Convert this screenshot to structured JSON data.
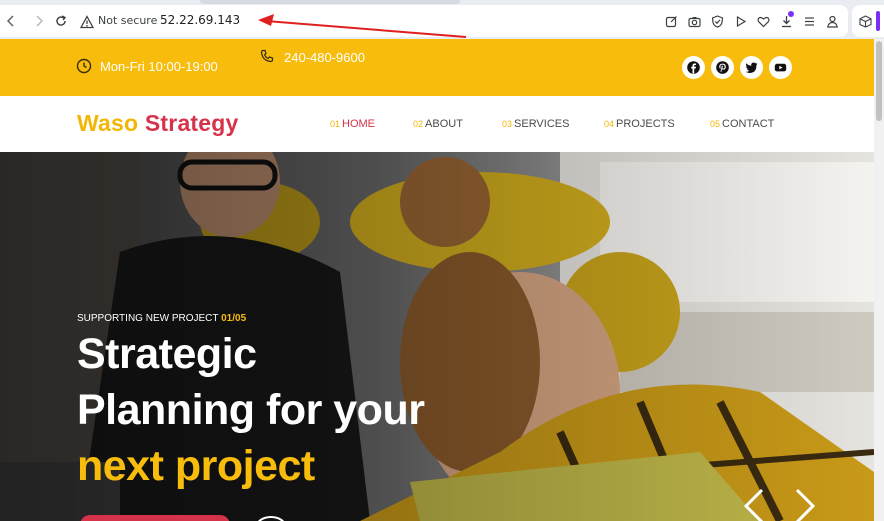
{
  "browser": {
    "security_status": "Not secure",
    "url": "52.22.69.143"
  },
  "topbar": {
    "hours": "Mon-Fri 10:00-19:00",
    "phone": "240-480-9600",
    "social_icons": [
      "facebook-icon",
      "pinterest-icon",
      "twitter-icon",
      "youtube-icon"
    ]
  },
  "header": {
    "logo_part1": "Waso",
    "logo_part2": "Strategy",
    "nav": [
      {
        "num": "01",
        "label": "HOME"
      },
      {
        "num": "02",
        "label": "ABOUT"
      },
      {
        "num": "03",
        "label": "SERVICES"
      },
      {
        "num": "04",
        "label": "PROJECTS"
      },
      {
        "num": "05",
        "label": "CONTACT"
      }
    ]
  },
  "hero": {
    "kicker": "SUPPORTING NEW PROJECT",
    "counter": "01/05",
    "line1": "Strategic",
    "line2": "Planning for your",
    "line3": "next project"
  },
  "colors": {
    "brand_yellow": "#f8bd0c",
    "brand_red": "#d6334a",
    "annotation_arrow": "#e02020"
  }
}
